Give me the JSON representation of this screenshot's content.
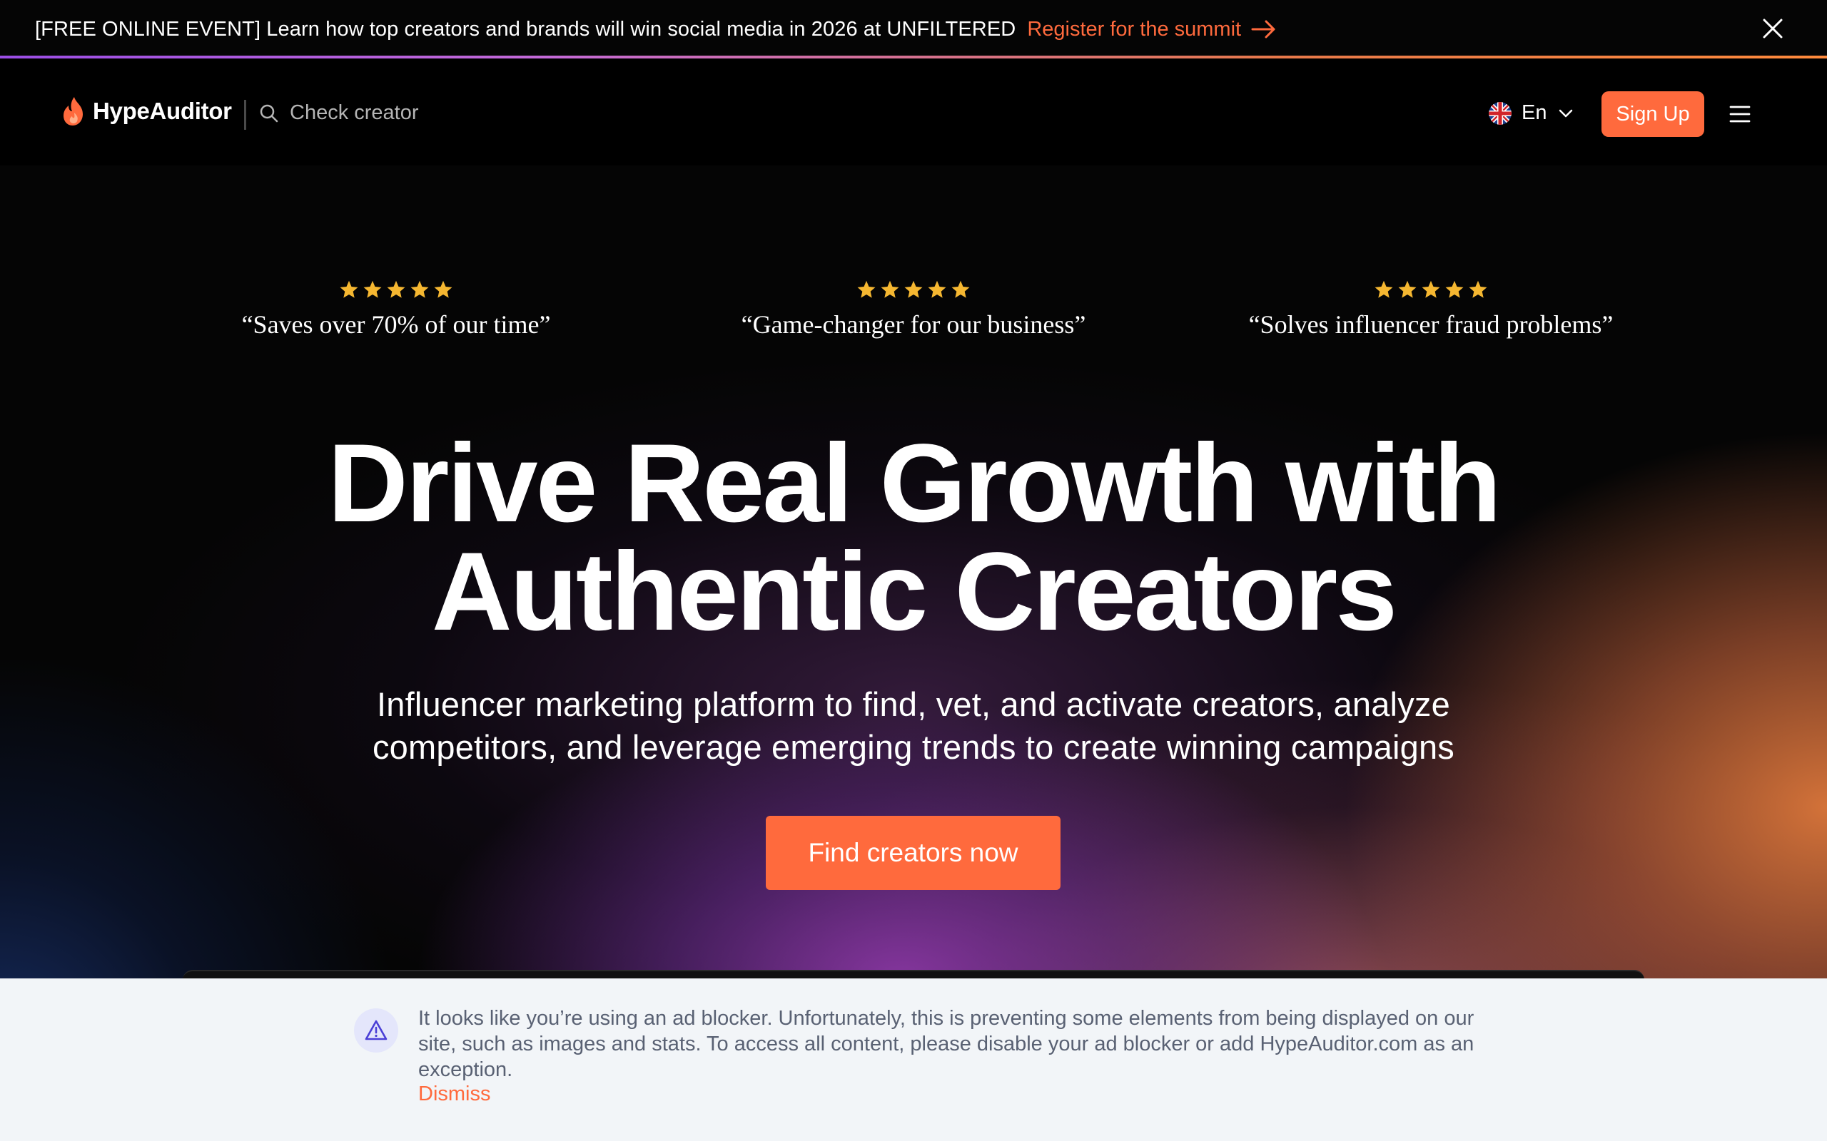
{
  "promo": {
    "text": "[FREE ONLINE EVENT] Learn how top creators and brands will win social media in 2026 at UNFILTERED",
    "link_label": "Register for the summit",
    "close_icon": "close-icon",
    "arrow_icon": "arrow-right-icon"
  },
  "nav": {
    "logo_text": "HypeAuditor",
    "search_placeholder": "Check creator",
    "language": "En",
    "signup_label": "Sign Up",
    "menu_icon": "hamburger-icon"
  },
  "reviews": [
    {
      "rating": 5,
      "quote": "“Saves over 70% of our time”"
    },
    {
      "rating": 5,
      "quote": "“Game-changer for our business”"
    },
    {
      "rating": 5,
      "quote": "“Solves influencer fraud problems”"
    }
  ],
  "hero": {
    "headline_line1": "Drive Real Growth with",
    "headline_line2": "Authentic Creators",
    "subhead_line1": "Influencer marketing platform to find, vet, and activate creators, analyze",
    "subhead_line2": "competitors, and leverage emerging trends to create winning campaigns",
    "cta_label": "Find creators now"
  },
  "adblock_notice": {
    "message": "It looks like you’re using an ad blocker. Unfortunately, this is preventing some elements from being displayed on our site, such as images and stats. To access all content, please disable your ad blocker or add HypeAuditor.com as an exception.",
    "dismiss_label": "Dismiss",
    "icon": "warning-icon"
  },
  "colors": {
    "accent": "#ff6a3d",
    "star": "#f5b731",
    "notice_bg": "#f2f5f8",
    "notice_text": "#596173"
  }
}
